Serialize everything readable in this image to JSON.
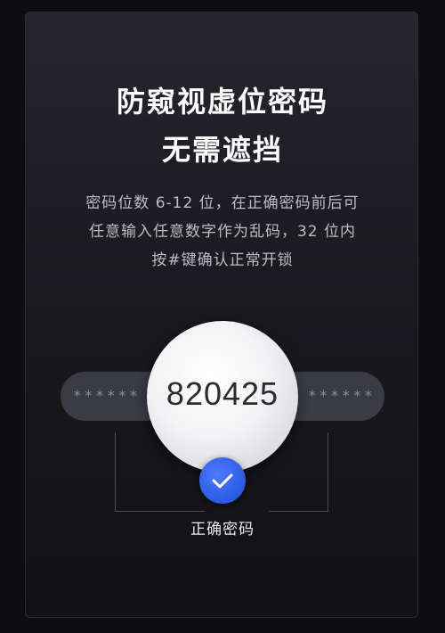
{
  "headline": {
    "line1": "防窥视虚位密码",
    "line2": "无需遮挡"
  },
  "description": {
    "line1": "密码位数 6-12 位，在正确密码前后可",
    "line2": "任意输入任意数字作为乱码，32 位内",
    "line3": "按#键确认正常开锁"
  },
  "illustration": {
    "masked_left": "******",
    "correct_code": "820425",
    "masked_right": "******",
    "check_label": "正确密码",
    "accent_color": "#2f5fe8",
    "icon": "check-icon"
  }
}
